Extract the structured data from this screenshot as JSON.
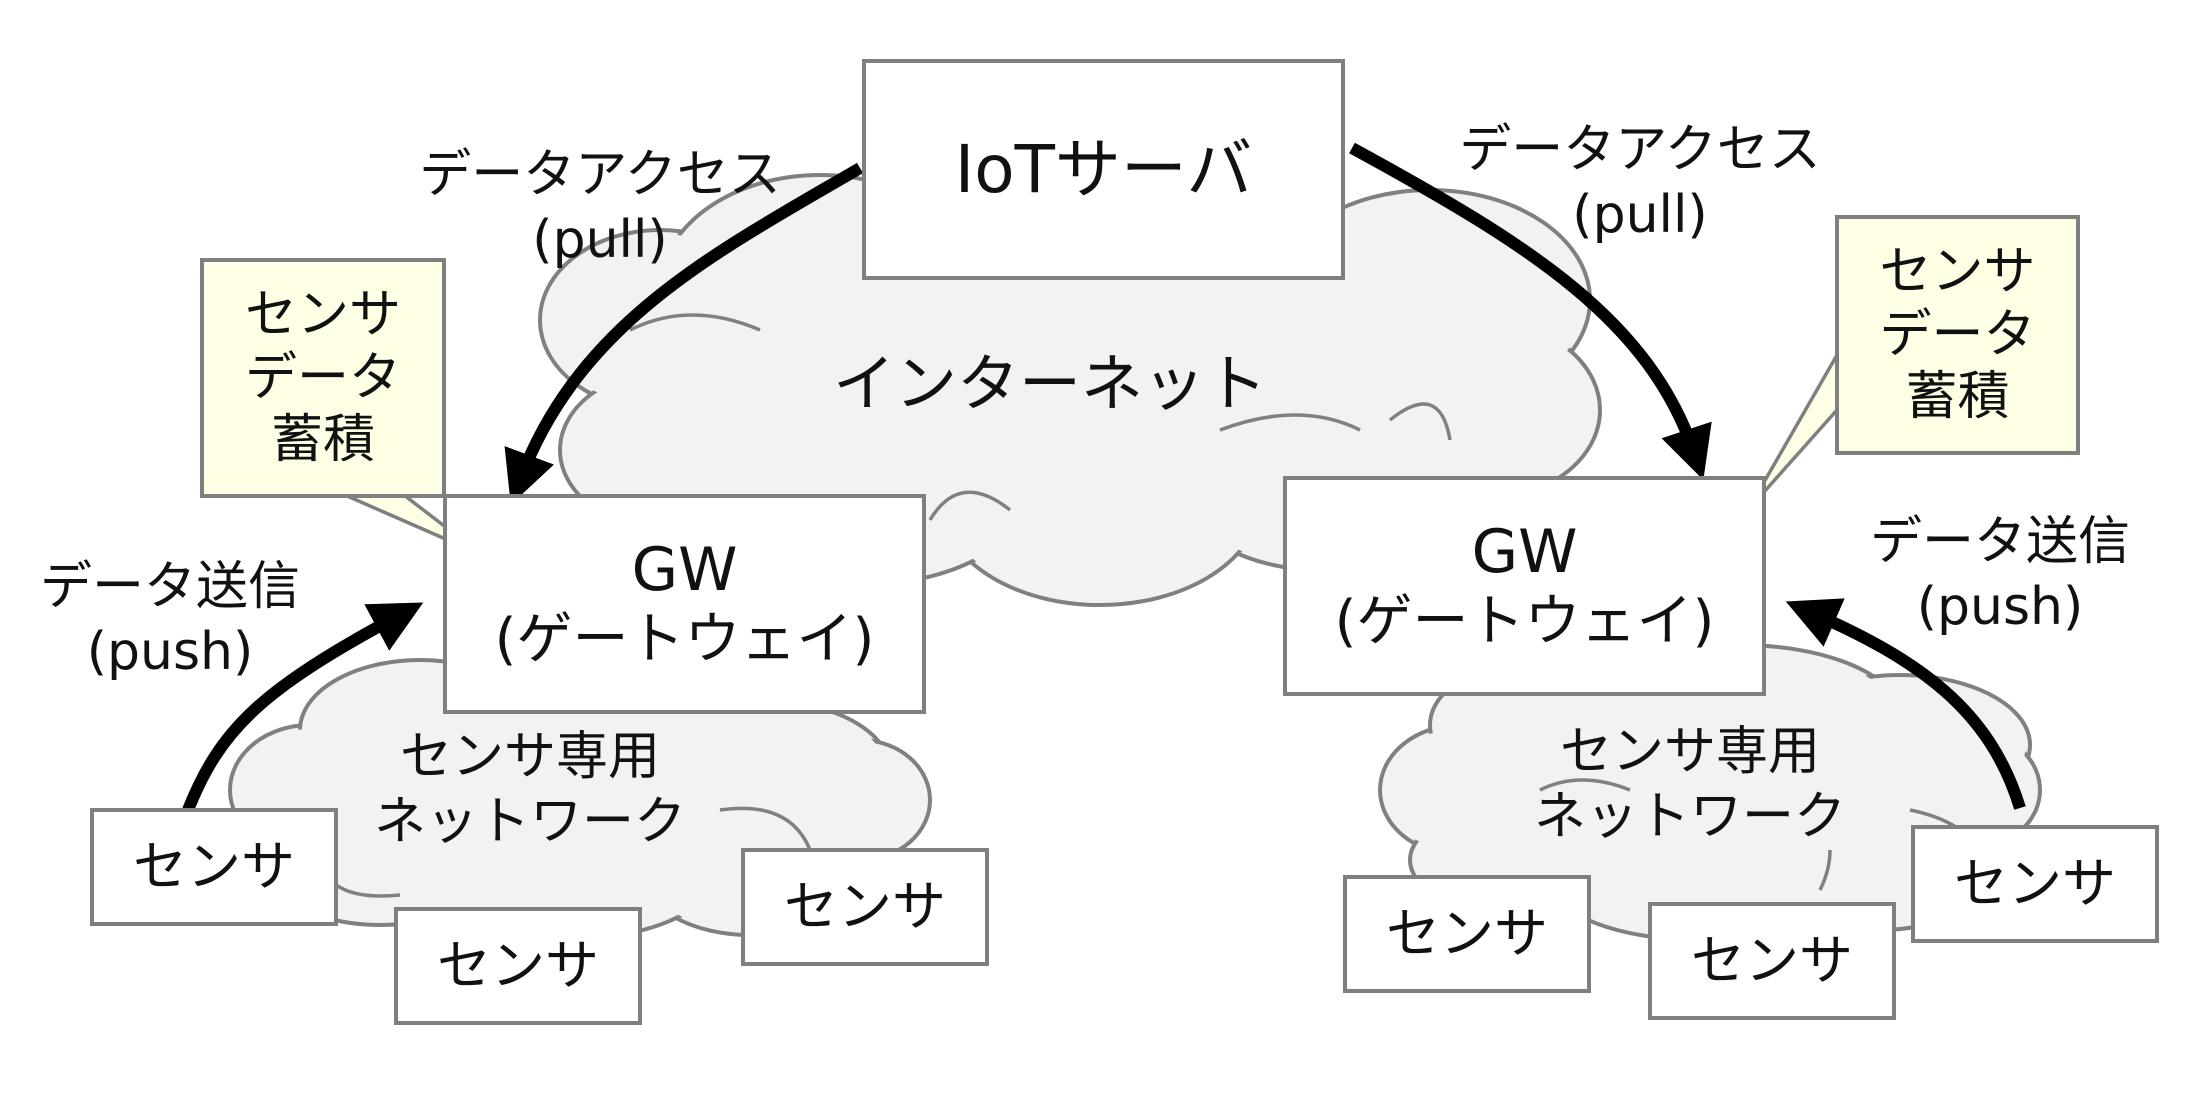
{
  "server": {
    "label": "IoTサーバ"
  },
  "internet": {
    "label": "インターネット"
  },
  "left": {
    "access": {
      "line1": "データアクセス",
      "line2": "(pull)"
    },
    "storage_note": {
      "line1": "センサ",
      "line2": "データ",
      "line3": "蓄積"
    },
    "gateway": {
      "line1": "GW",
      "line2": "(ゲートウェイ)"
    },
    "send": {
      "line1": "データ送信",
      "line2": "(push)"
    },
    "sensor_network": {
      "line1": "センサ専用",
      "line2": "ネットワーク"
    },
    "sensors": [
      "センサ",
      "センサ",
      "センサ"
    ]
  },
  "right": {
    "access": {
      "line1": "データアクセス",
      "line2": "(pull)"
    },
    "storage_note": {
      "line1": "センサ",
      "line2": "データ",
      "line3": "蓄積"
    },
    "gateway": {
      "line1": "GW",
      "line2": "(ゲートウェイ)"
    },
    "send": {
      "line1": "データ送信",
      "line2": "(push)"
    },
    "sensor_network": {
      "line1": "センサ専用",
      "line2": "ネットワーク"
    },
    "sensors": [
      "センサ",
      "センサ",
      "センサ"
    ]
  },
  "colors": {
    "cloud_fill": "#f2f2f2",
    "cloud_stroke": "#808080",
    "box_border": "#7f7f7f",
    "note_fill": "#ffffe6",
    "arrow": "#000000"
  }
}
